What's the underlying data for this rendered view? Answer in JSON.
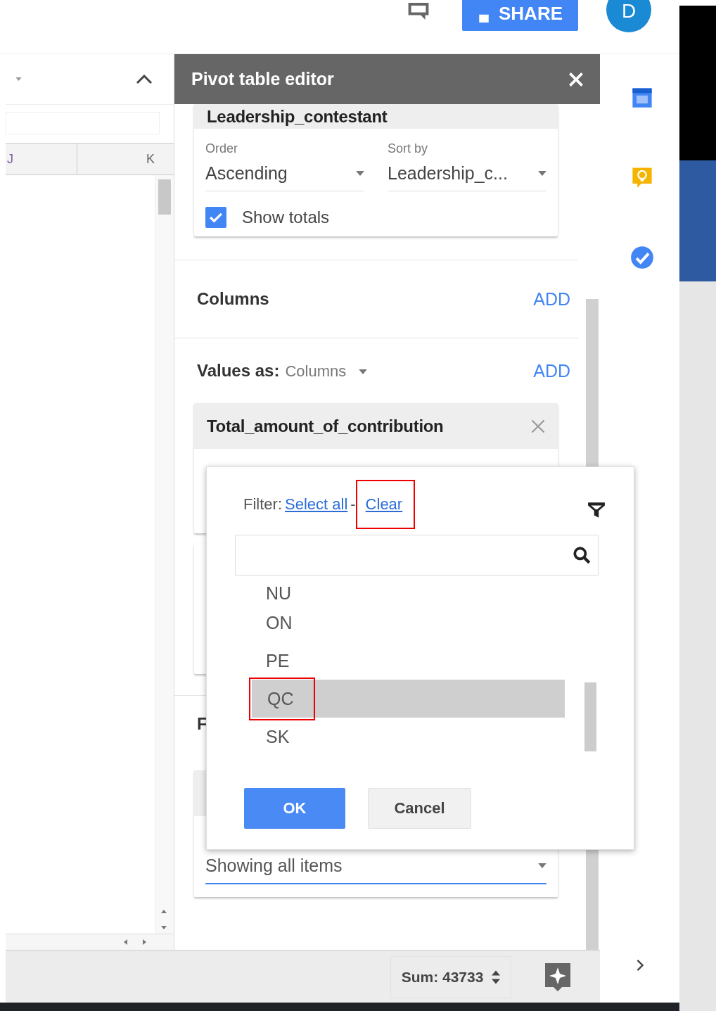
{
  "topbar": {
    "share_label": "SHARE",
    "avatar": "D"
  },
  "sheet": {
    "columns": [
      "J",
      "K"
    ]
  },
  "pivot_editor": {
    "title": "Pivot table editor",
    "rows_card": {
      "field": "Leadership_contestant",
      "order_label": "Order",
      "order_value": "Ascending",
      "sort_label": "Sort by",
      "sort_value": "Leadership_c...",
      "show_totals": {
        "label": "Show totals",
        "checked": true
      }
    },
    "columns_section": {
      "label": "Columns",
      "add": "ADD"
    },
    "values_section": {
      "label": "Values as:",
      "mode": "Columns",
      "add": "ADD",
      "field": "Total_amount_of_contribution"
    },
    "filters_section": {
      "label": "F",
      "filter_value": "Showing all items"
    }
  },
  "filter_popup": {
    "filter_label": "Filter:",
    "select_all": "Select all",
    "separator": "-",
    "clear": {
      "label": "Clear",
      "annotated": true
    },
    "items": [
      {
        "label": "NU",
        "selected": false,
        "annotated": false
      },
      {
        "label": "ON",
        "selected": false,
        "annotated": false
      },
      {
        "label": "PE",
        "selected": false,
        "annotated": false
      },
      {
        "label": "QC",
        "selected": true,
        "annotated": true
      },
      {
        "label": "SK",
        "selected": false,
        "annotated": false
      }
    ],
    "ok": "OK",
    "cancel": "Cancel"
  },
  "status_bar": {
    "sum": "Sum: 43733"
  }
}
